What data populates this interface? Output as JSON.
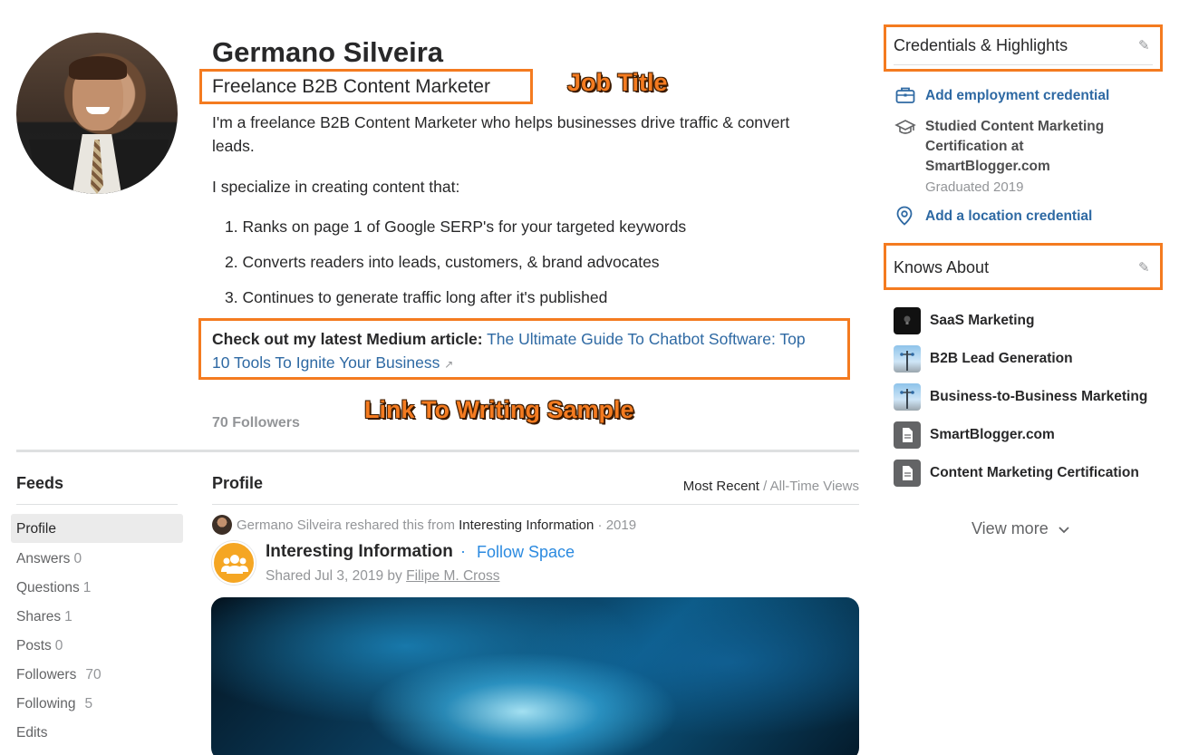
{
  "profile": {
    "name": "Germano Silveira",
    "job_title": "Freelance B2B Content Marketer",
    "bio_1_line1": "I'm a freelance B2B Content Marketer who helps businesses drive traffic & convert",
    "bio_1_line2": "leads.",
    "bio_2": "I specialize in creating content that:",
    "list": [
      "1. Ranks on page 1 of Google SERP's for your targeted keywords",
      "2. Converts readers into leads, customers, & brand advocates",
      "3. Continues to generate traffic long after it's published"
    ],
    "medium_prefix": "Check out my latest Medium article:",
    "medium_link_line1": "The Ultimate Guide To Chatbot Software: Top",
    "medium_link_line2": "10 Tools To Ignite Your Business",
    "followers": "70 Followers"
  },
  "annotations": {
    "job_title": "Job Title",
    "writing_sample": "Link To Writing Sample"
  },
  "nav": {
    "title": "Feeds",
    "items": [
      {
        "label": "Profile",
        "count": ""
      },
      {
        "label": "Answers",
        "count": "0"
      },
      {
        "label": "Questions",
        "count": "1"
      },
      {
        "label": "Shares",
        "count": "1"
      },
      {
        "label": "Posts",
        "count": "0"
      },
      {
        "label": "Followers",
        "count": "70"
      },
      {
        "label": "Following",
        "count": "5"
      },
      {
        "label": "Edits",
        "count": ""
      }
    ]
  },
  "feed": {
    "title": "Profile",
    "sort_active": "Most Recent",
    "sort_sep": " / ",
    "sort_other": "All-Time Views",
    "reshare_user": "Germano Silveira",
    "reshare_text": " reshared this from ",
    "reshare_space": "Interesting Information",
    "reshare_year": " · 2019",
    "space_title": "Interesting Information",
    "dot": "·",
    "follow_space": "Follow Space",
    "shared_prefix": "Shared Jul 3, 2019 by ",
    "shared_by": "Filipe M. Cross"
  },
  "credentials": {
    "title": "Credentials & Highlights",
    "add_employment": "Add employment credential",
    "studied_line1": "Studied Content Marketing",
    "studied_line2": "Certification at",
    "studied_line3": "SmartBlogger.com",
    "graduated": "Graduated 2019",
    "add_location": "Add a location credential"
  },
  "knows_about": {
    "title": "Knows About",
    "topics": [
      {
        "label": "SaaS Marketing",
        "icon": "bulb-icon"
      },
      {
        "label": "B2B Lead Generation",
        "icon": "topic-photo-icon"
      },
      {
        "label": "Business-to-Business Marketing",
        "icon": "topic-photo-icon"
      },
      {
        "label": "SmartBlogger.com",
        "icon": "document-icon"
      },
      {
        "label": "Content Marketing Certification",
        "icon": "document-icon"
      }
    ],
    "view_more": "View more"
  },
  "colors": {
    "annotation_orange": "#f47b20",
    "link_blue": "#2e69a3",
    "follow_blue": "#2b8ae0",
    "muted_gray": "#939598"
  }
}
